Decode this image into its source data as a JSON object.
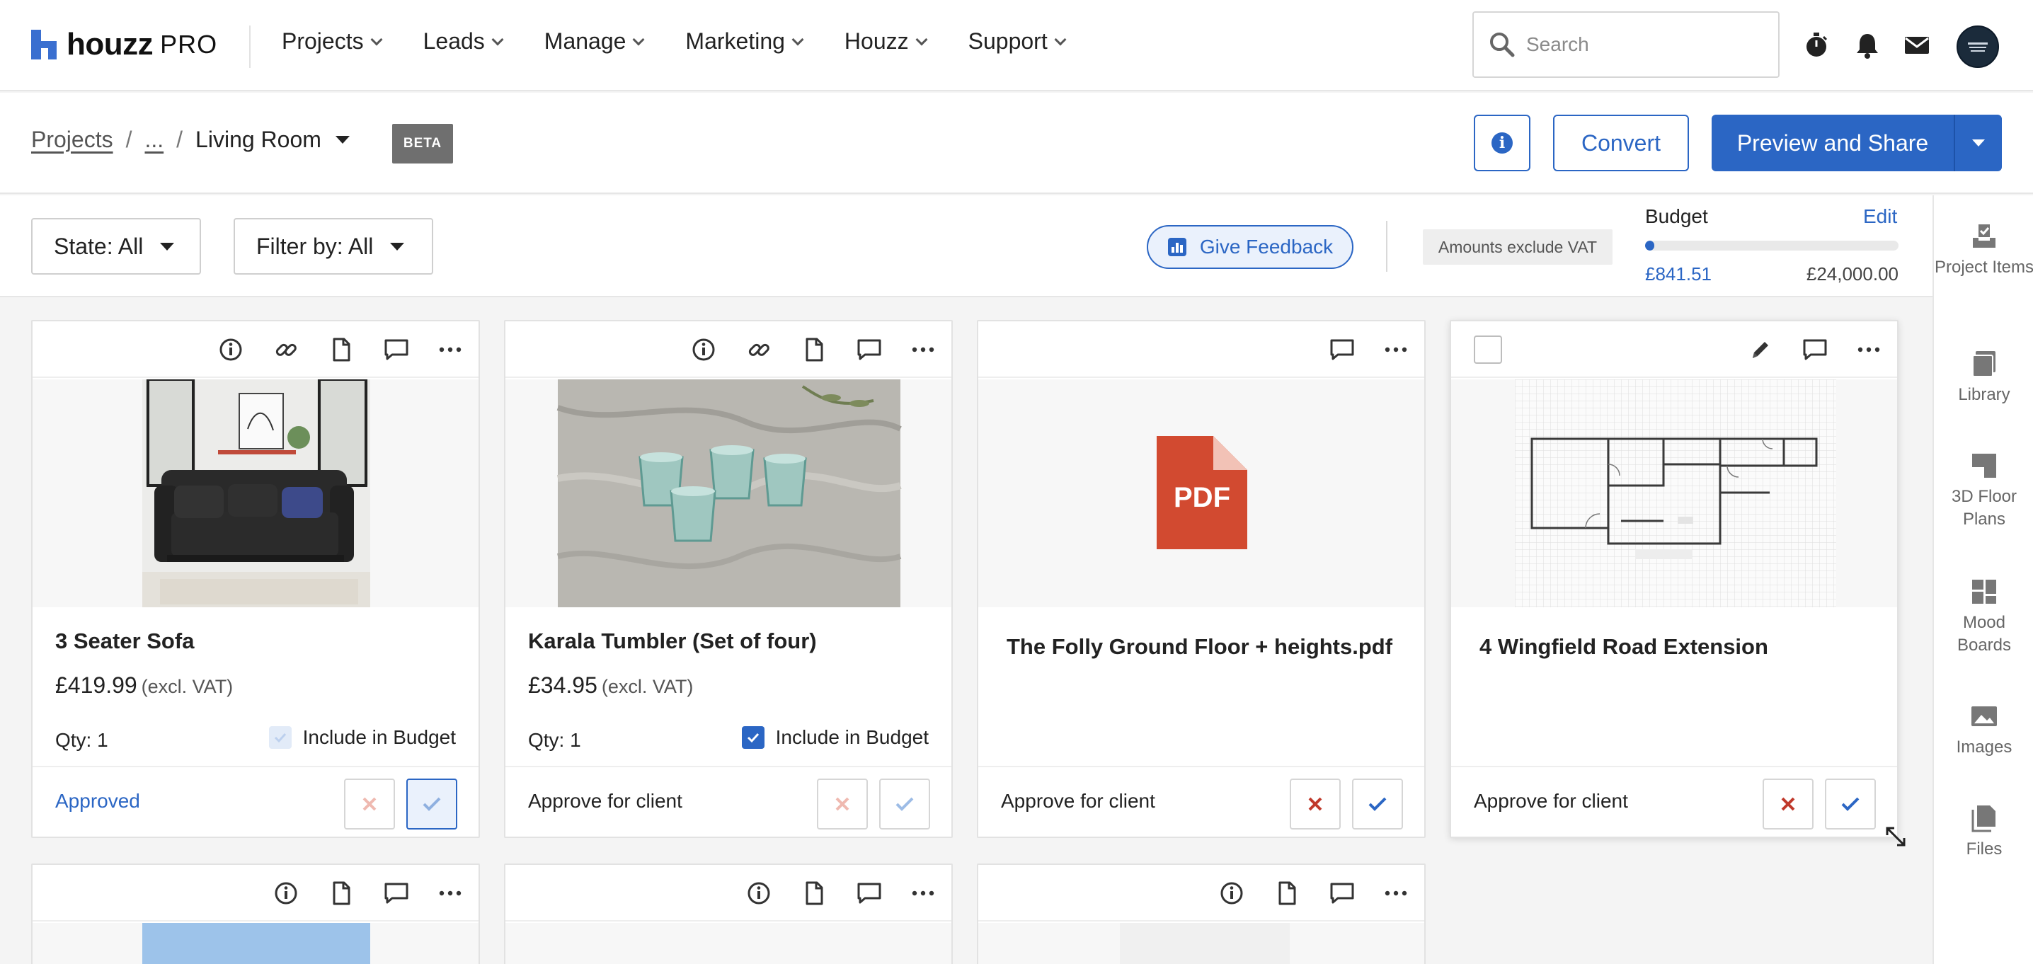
{
  "nav": {
    "brand": "houzz",
    "brand_suffix": "PRO",
    "menu": [
      {
        "label": "Projects"
      },
      {
        "label": "Leads"
      },
      {
        "label": "Manage"
      },
      {
        "label": "Marketing"
      },
      {
        "label": "Houzz"
      },
      {
        "label": "Support"
      }
    ],
    "search_placeholder": "Search"
  },
  "breadcrumb": {
    "root": "Projects",
    "ellipsis": "...",
    "current": "Living Room",
    "badge": "BETA"
  },
  "actions": {
    "convert": "Convert",
    "preview_share": "Preview and Share"
  },
  "filters": {
    "state": "State: All",
    "filter_by": "Filter by: All",
    "feedback": "Give Feedback",
    "vat_note": "Amounts exclude VAT"
  },
  "budget": {
    "title": "Budget",
    "edit": "Edit",
    "spent": "£841.51",
    "total": "£24,000.00",
    "spent_fraction": 0.035
  },
  "rail": [
    {
      "label": "Project Items",
      "icon": "project-items-icon"
    },
    {
      "label": "Library",
      "icon": "library-icon"
    },
    {
      "label": "3D Floor Plans",
      "icon": "floor-plan-icon"
    },
    {
      "label": "Mood Boards",
      "icon": "mood-board-icon"
    },
    {
      "label": "Images",
      "icon": "image-icon"
    },
    {
      "label": "Files",
      "icon": "files-icon"
    }
  ],
  "cards": [
    {
      "name": "3 Seater Sofa",
      "price": "£419.99",
      "vat": "(excl. VAT)",
      "qty": "Qty: 1",
      "include": "Include in Budget",
      "status": "Approved"
    },
    {
      "name": "Karala Tumbler (Set of four)",
      "price": "£34.95",
      "vat": "(excl. VAT)",
      "qty": "Qty: 1",
      "include": "Include in Budget",
      "status": "Approve for client"
    },
    {
      "name": "The Folly Ground Floor + heights.pdf",
      "file_type": "PDF",
      "status": "Approve for client"
    },
    {
      "name": "4 Wingfield Road Extension",
      "status": "Approve for client"
    }
  ],
  "colors": {
    "accent": "#2b66c4",
    "reject": "#c0392b",
    "pdf": "#d24a30",
    "rail_icon": "#777777"
  }
}
